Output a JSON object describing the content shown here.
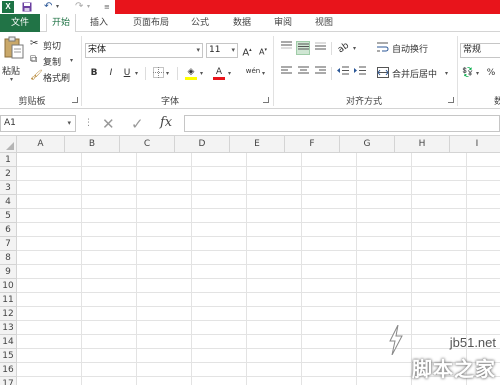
{
  "titlebar": {
    "logo": "X"
  },
  "tabs": {
    "file": "文件",
    "items": [
      {
        "label": "开始",
        "active": true
      },
      {
        "label": "插入",
        "active": false
      },
      {
        "label": "页面布局",
        "active": false
      },
      {
        "label": "公式",
        "active": false
      },
      {
        "label": "数据",
        "active": false
      },
      {
        "label": "审阅",
        "active": false
      },
      {
        "label": "视图",
        "active": false
      }
    ]
  },
  "ribbon": {
    "clipboard": {
      "paste": "粘贴",
      "cut": "剪切",
      "copy": "复制",
      "format_painter": "格式刷",
      "group_label": "剪贴板"
    },
    "font": {
      "font_name": "宋体",
      "font_size": "11",
      "grow": "A",
      "shrink": "A",
      "bold": "B",
      "italic": "I",
      "underline": "U",
      "font_color_glyph": "A",
      "phonetic": "wén",
      "group_label": "字体"
    },
    "alignment": {
      "wrap_text": "自动换行",
      "merge_center": "合并后居中",
      "group_label": "对齐方式"
    },
    "number": {
      "format": "常规",
      "percent": "%",
      "group_label": "数"
    }
  },
  "formula_bar": {
    "name_box": "A1",
    "fx": "fx"
  },
  "grid": {
    "columns": [
      "A",
      "B",
      "C",
      "D",
      "E",
      "F",
      "G",
      "H",
      "I"
    ],
    "rows": [
      "1",
      "2",
      "3",
      "4",
      "5",
      "6",
      "7",
      "8",
      "9",
      "10",
      "11",
      "12",
      "13",
      "14",
      "15",
      "16",
      "17"
    ]
  },
  "watermark": {
    "site": "jb51.net",
    "brand": "脚本之家"
  },
  "colors": {
    "accent": "#217346",
    "red_bar": "#e8141b",
    "font_color_bar": "#e8141b",
    "highlight_bar": "#ffff00"
  }
}
